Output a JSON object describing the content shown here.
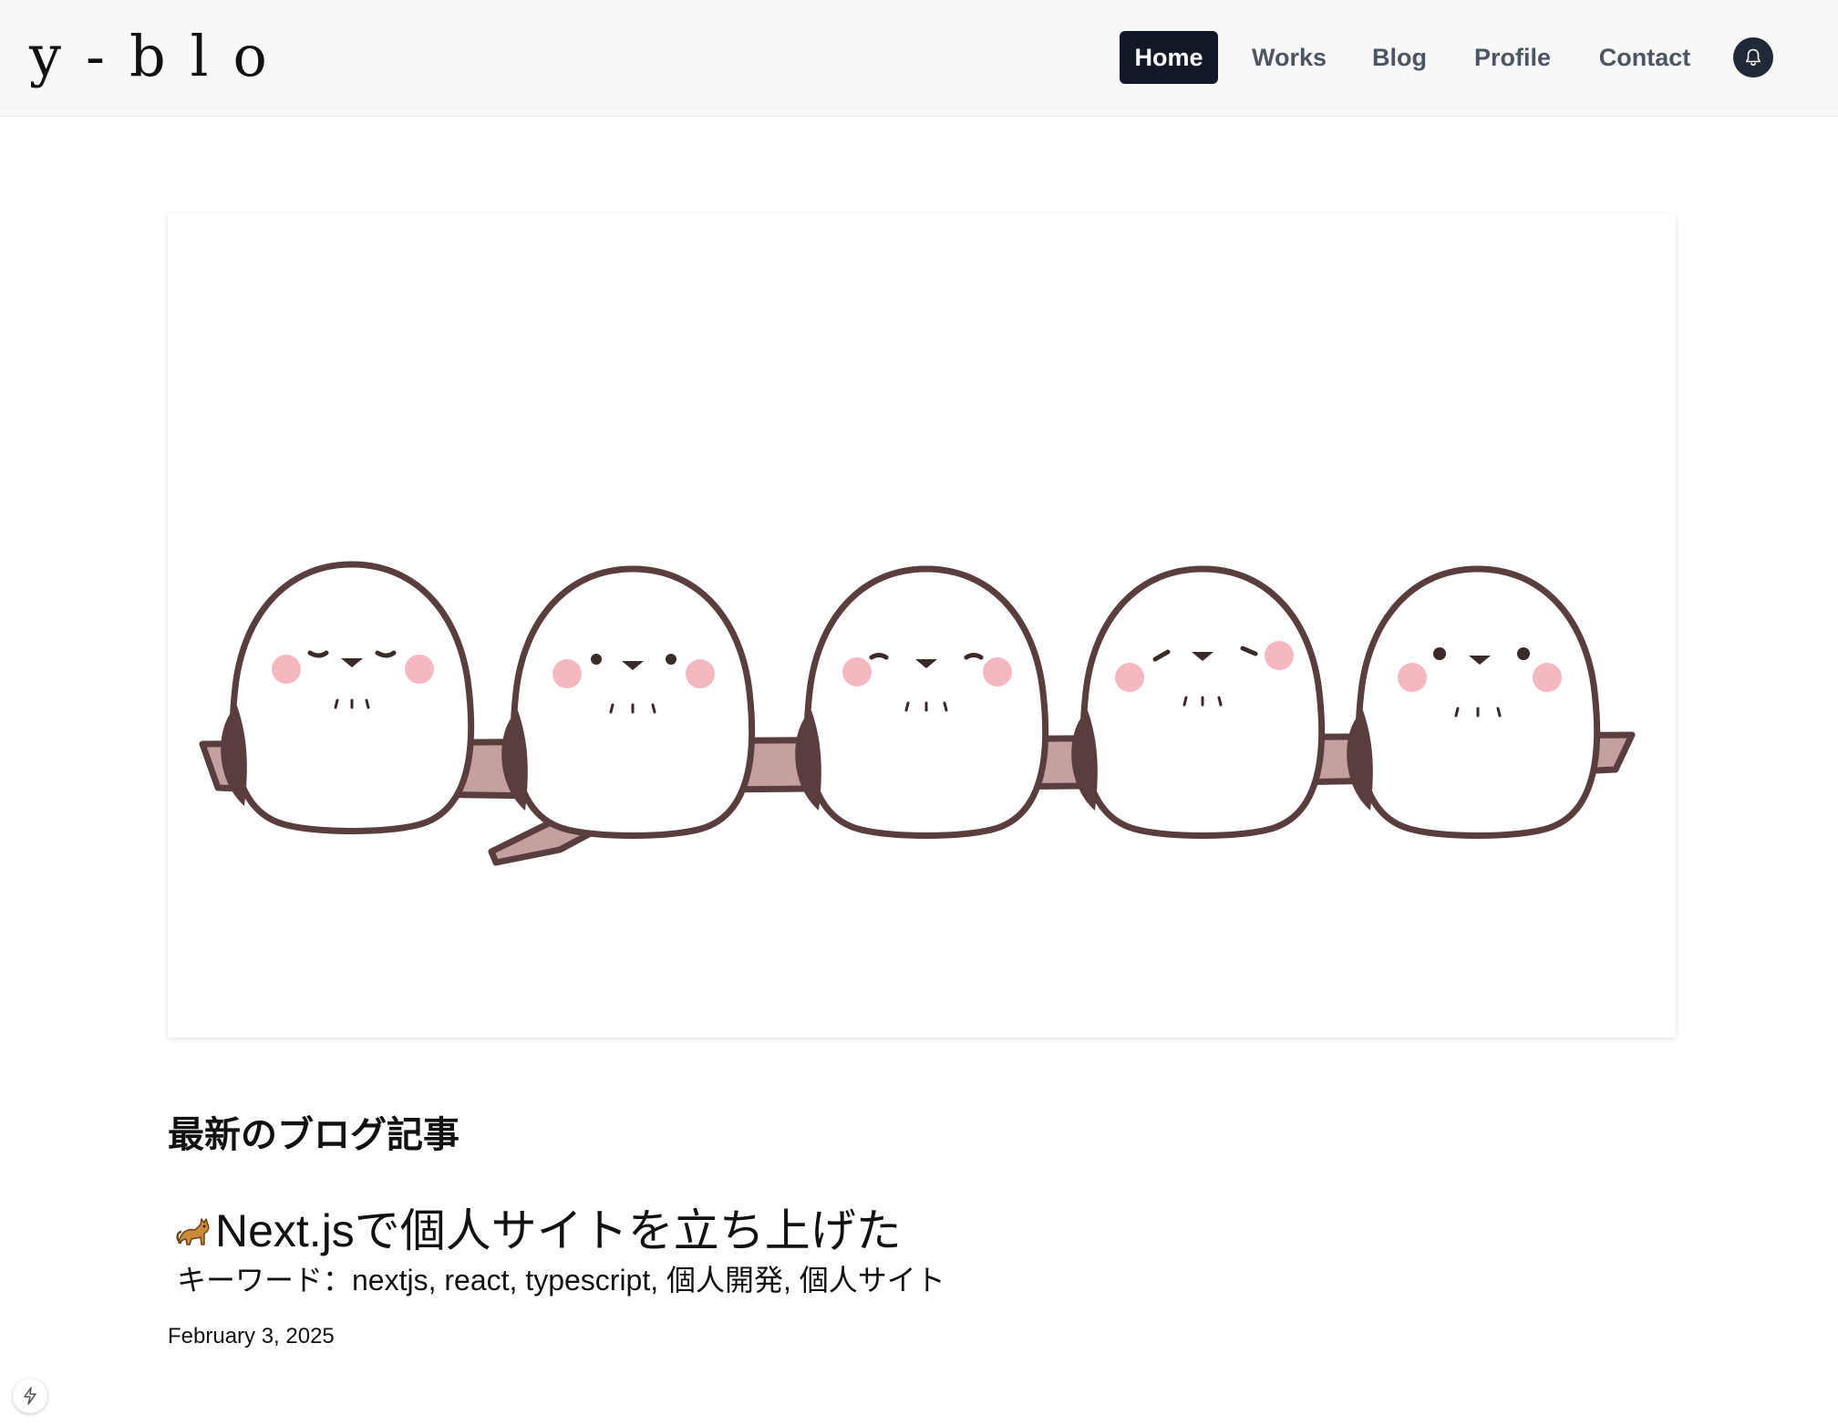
{
  "header": {
    "logo": "y-blo",
    "nav": {
      "home": "Home",
      "works": "Works",
      "blog": "Blog",
      "profile": "Profile",
      "contact": "Contact"
    },
    "active_item": "Home",
    "accent_color": "#111827",
    "notification_icon": "bell-icon"
  },
  "hero": {
    "illustration": "five long-tailed tits perched on a branch"
  },
  "latest": {
    "section_title": "最新のブログ記事",
    "post": {
      "emoji_icon": "cat-icon",
      "title": "Next.jsで個人サイトを立ち上げた",
      "keywords": "キーワード：nextjs, react, typescript, 個人開発, 個人サイト",
      "date": "February 3, 2025"
    }
  },
  "devtools": {
    "icon": "lightning-icon"
  }
}
